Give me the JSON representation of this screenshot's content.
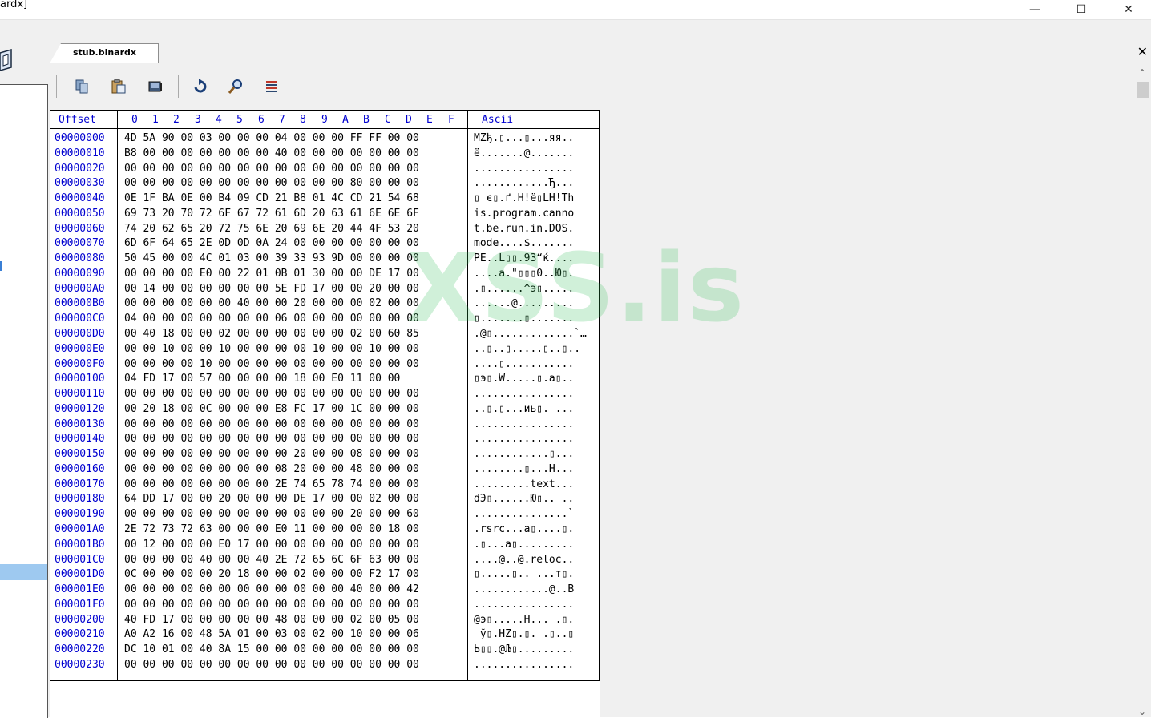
{
  "window": {
    "title": "ardx]",
    "minimize_glyph": "—",
    "maximize_glyph": "☐",
    "close_glyph": "✕"
  },
  "tab": {
    "label": "stub.binardx",
    "close_glyph": "✕"
  },
  "toolbar": {
    "icons": [
      "copy-icon",
      "paste-icon",
      "dump-icon",
      "refresh-icon",
      "search-icon",
      "list-icon"
    ]
  },
  "hex": {
    "offset_header": "Offset",
    "columns": [
      "0",
      "1",
      "2",
      "3",
      "4",
      "5",
      "6",
      "7",
      "8",
      "9",
      "A",
      "B",
      "C",
      "D",
      "E",
      "F"
    ],
    "ascii_header": "Ascii",
    "rows": [
      {
        "offset": "00000000",
        "hex": "4D 5A 90 00 03 00 00 00 04 00 00 00 FF FF 00 00",
        "ascii": "MZђ.▯...▯...яя.."
      },
      {
        "offset": "00000010",
        "hex": "B8 00 00 00 00 00 00 00 40 00 00 00 00 00 00 00",
        "ascii": "ё.......@......."
      },
      {
        "offset": "00000020",
        "hex": "00 00 00 00 00 00 00 00 00 00 00 00 00 00 00 00",
        "ascii": "................"
      },
      {
        "offset": "00000030",
        "hex": "00 00 00 00 00 00 00 00 00 00 00 00 80 00 00 00",
        "ascii": "............Ђ..."
      },
      {
        "offset": "00000040",
        "hex": "0E 1F BA 0E 00 B4 09 CD 21 B8 01 4C CD 21 54 68",
        "ascii": "▯ є▯.ґ.Н!ё▯LН!Th"
      },
      {
        "offset": "00000050",
        "hex": "69 73 20 70 72 6F 67 72 61 6D 20 63 61 6E 6E 6F",
        "ascii": "is.program.canno"
      },
      {
        "offset": "00000060",
        "hex": "74 20 62 65 20 72 75 6E 20 69 6E 20 44 4F 53 20",
        "ascii": "t.be.run.in.DOS."
      },
      {
        "offset": "00000070",
        "hex": "6D 6F 64 65 2E 0D 0D 0A 24 00 00 00 00 00 00 00",
        "ascii": "mode....$......."
      },
      {
        "offset": "00000080",
        "hex": "50 45 00 00 4C 01 03 00 39 33 93 9D 00 00 00 00",
        "ascii": "PE..L▯▯.93“ќ...."
      },
      {
        "offset": "00000090",
        "hex": "00 00 00 00 E0 00 22 01 0B 01 30 00 00 DE 17 00",
        "ascii": "....а.\"▯▯▯0..Ю▯."
      },
      {
        "offset": "000000A0",
        "hex": "00 14 00 00 00 00 00 00 5E FD 17 00 00 20 00 00",
        "ascii": ".▯......^э▯....."
      },
      {
        "offset": "000000B0",
        "hex": "00 00 00 00 00 00 40 00 00 20 00 00 00 02 00 00",
        "ascii": "......@........."
      },
      {
        "offset": "000000C0",
        "hex": "04 00 00 00 00 00 00 00 06 00 00 00 00 00 00 00",
        "ascii": "▯.......▯......."
      },
      {
        "offset": "000000D0",
        "hex": "00 40 18 00 00 02 00 00 00 00 00 00 02 00 60 85",
        "ascii": ".@▯.............`…"
      },
      {
        "offset": "000000E0",
        "hex": "00 00 10 00 00 10 00 00 00 00 10 00 00 10 00 00",
        "ascii": "..▯..▯.....▯..▯.."
      },
      {
        "offset": "000000F0",
        "hex": "00 00 00 00 10 00 00 00 00 00 00 00 00 00 00 00",
        "ascii": "....▯..........."
      },
      {
        "offset": "00000100",
        "hex": "04 FD 17 00 57 00 00 00 00 18 00 E0 11 00 00",
        "ascii": "▯э▯.W.....▯.а▯.."
      },
      {
        "offset": "00000110",
        "hex": "00 00 00 00 00 00 00 00 00 00 00 00 00 00 00 00",
        "ascii": "................"
      },
      {
        "offset": "00000120",
        "hex": "00 20 18 00 0C 00 00 00 E8 FC 17 00 1C 00 00 00",
        "ascii": "..▯.▯...иь▯. ..."
      },
      {
        "offset": "00000130",
        "hex": "00 00 00 00 00 00 00 00 00 00 00 00 00 00 00 00",
        "ascii": "................"
      },
      {
        "offset": "00000140",
        "hex": "00 00 00 00 00 00 00 00 00 00 00 00 00 00 00 00",
        "ascii": "................"
      },
      {
        "offset": "00000150",
        "hex": "00 00 00 00 00 00 00 00 00 20 00 00 08 00 00 00",
        "ascii": "............▯..."
      },
      {
        "offset": "00000160",
        "hex": "00 00 00 00 00 00 00 00 08 20 00 00 48 00 00 00",
        "ascii": "........▯...H..."
      },
      {
        "offset": "00000170",
        "hex": "00 00 00 00 00 00 00 00 2E 74 65 78 74 00 00 00",
        "ascii": ".........text..."
      },
      {
        "offset": "00000180",
        "hex": "64 DD 17 00 00 20 00 00 00 DE 17 00 00 02 00 00",
        "ascii": "dЭ▯......Ю▯.. .."
      },
      {
        "offset": "00000190",
        "hex": "00 00 00 00 00 00 00 00 00 00 00 00 20 00 00 60",
        "ascii": "...............`"
      },
      {
        "offset": "000001A0",
        "hex": "2E 72 73 72 63 00 00 00 E0 11 00 00 00 00 18 00",
        "ascii": ".rsrc...а▯....▯."
      },
      {
        "offset": "000001B0",
        "hex": "00 12 00 00 00 E0 17 00 00 00 00 00 00 00 00 00",
        "ascii": ".▯...а▯........."
      },
      {
        "offset": "000001C0",
        "hex": "00 00 00 00 40 00 00 40 2E 72 65 6C 6F 63 00 00",
        "ascii": "....@..@.reloc.."
      },
      {
        "offset": "000001D0",
        "hex": "0C 00 00 00 00 20 18 00 00 02 00 00 00 F2 17 00",
        "ascii": "▯.....▯.. ...т▯."
      },
      {
        "offset": "000001E0",
        "hex": "00 00 00 00 00 00 00 00 00 00 00 00 40 00 00 42",
        "ascii": "............@..B"
      },
      {
        "offset": "000001F0",
        "hex": "00 00 00 00 00 00 00 00 00 00 00 00 00 00 00 00",
        "ascii": "................"
      },
      {
        "offset": "00000200",
        "hex": "40 FD 17 00 00 00 00 00 48 00 00 00 02 00 05 00",
        "ascii": "@э▯.....H... .▯."
      },
      {
        "offset": "00000210",
        "hex": "A0 A2 16 00 48 5A 01 00 03 00 02 00 10 00 00 06",
        "ascii": " ў▯.HZ▯.▯. .▯..▯"
      },
      {
        "offset": "00000220",
        "hex": "DC 10 01 00 40 8A 15 00 00 00 00 00 00 00 00 00",
        "ascii": "Ь▯▯.@Љ▯........."
      },
      {
        "offset": "00000230",
        "hex": "00 00 00 00 00 00 00 00 00 00 00 00 00 00 00 00",
        "ascii": "................"
      }
    ]
  },
  "watermark": "XSS.is",
  "scrollbar": {
    "up_glyph": "⌃",
    "down_glyph": "⌄"
  }
}
